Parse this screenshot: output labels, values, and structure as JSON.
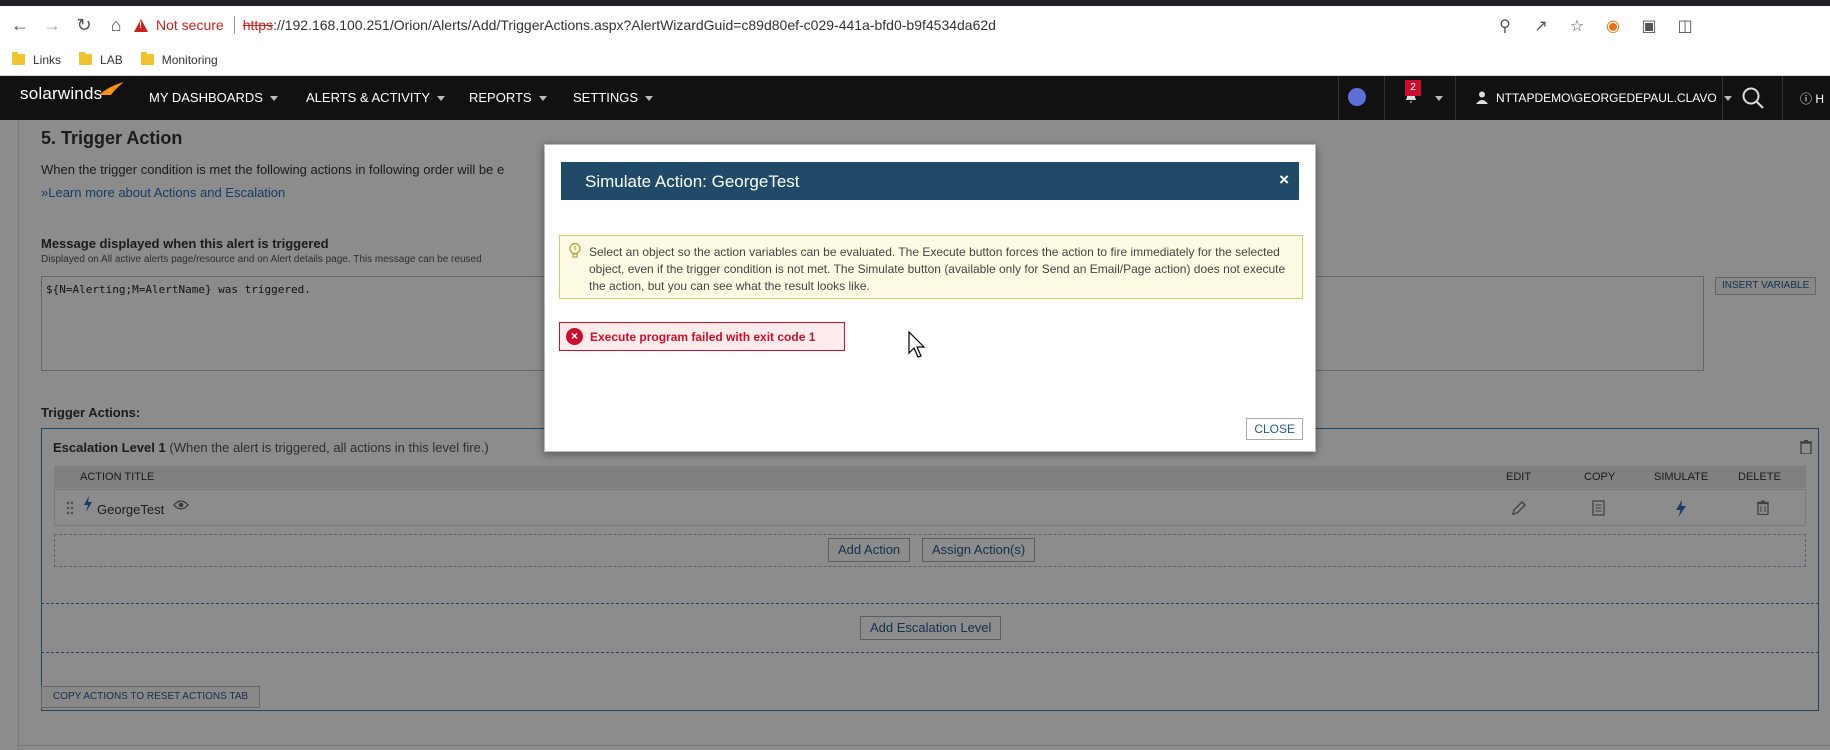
{
  "browser": {
    "not_secure": "Not secure",
    "url_https": "https",
    "url_rest": "://192.168.100.251/Orion/Alerts/Add/TriggerActions.aspx?AlertWizardGuid=c89d80ef-c029-441a-bfd0-b9f4534da62d",
    "bookmarks": [
      "Links",
      "LAB",
      "Monitoring"
    ]
  },
  "nav": {
    "logo": "solarwinds",
    "items": [
      "MY DASHBOARDS",
      "ALERTS & ACTIVITY",
      "REPORTS",
      "SETTINGS"
    ],
    "alert_count": "2",
    "user": "NTTAPDEMO\\GEORGEDEPAUL.CLAVO",
    "help": "H"
  },
  "page": {
    "section_title": "5. Trigger Action",
    "section_desc": "When the trigger condition is met the following actions in following order will be e",
    "learn_link": "»Learn more about Actions and Escalation",
    "msg_label": "Message displayed when this alert is triggered",
    "msg_sub": "Displayed on All active alerts page/resource and on Alert details page. This message can be reused",
    "msg_value": "${N=Alerting;M=AlertName} was triggered.",
    "insert_variable": "INSERT VARIABLE",
    "trigger_actions_label": "Trigger Actions:",
    "escalation_title": "Escalation Level 1",
    "escalation_note": "(When the alert is triggered, all actions in this level fire.)",
    "columns": {
      "title": "ACTION TITLE",
      "edit": "EDIT",
      "copy": "COPY",
      "simulate": "SIMULATE",
      "delete": "DELETE"
    },
    "action_name": "GeorgeTest",
    "add_action": "Add Action",
    "assign_actions": "Assign Action(s)",
    "add_escalation": "Add Escalation Level",
    "copy_actions": "COPY ACTIONS TO RESET ACTIONS TAB"
  },
  "dialog": {
    "title": "Simulate Action: GeorgeTest",
    "close_x": "×",
    "hint": "Select an object so the action variables can be evaluated. The Execute button forces the action to fire immediately for the selected object, even if the trigger condition is not met. The Simulate button (available only for Send an Email/Page action) does not execute the action, but you can see what the result looks like.",
    "error": "Execute program failed with exit code 1",
    "close_button": "CLOSE"
  },
  "colors": {
    "nav_bg": "#111111",
    "dialog_header": "#204a67",
    "error_red": "#c8102e",
    "link_blue": "#2a6ebb"
  }
}
